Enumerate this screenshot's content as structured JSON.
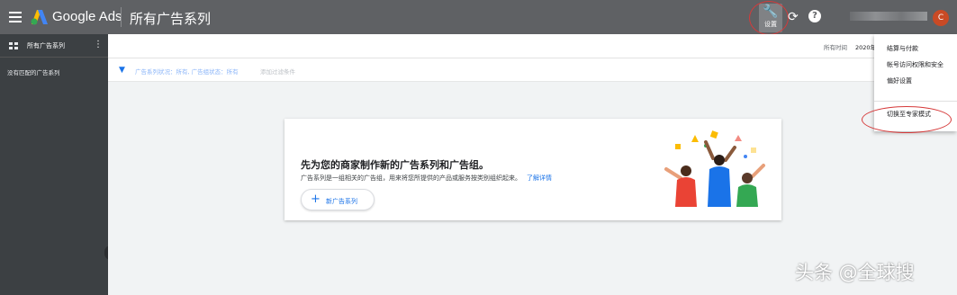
{
  "app": {
    "brand": "Google Ads",
    "page_title": "所有广告系列",
    "settings_label": "设置",
    "avatar_initial": "C"
  },
  "sidebar": {
    "title": "所有广告系列",
    "empty_text": "没有匹配的广告系列"
  },
  "datebar": {
    "label": "所有时间",
    "value": "2020年"
  },
  "filter": {
    "status_text": "广告系列状况：所有, 广告组状态：所有",
    "add_filter": "添加过滤条件"
  },
  "card": {
    "title": "先为您的商家制作新的广告系列和广告组。",
    "description": "广告系列是一组相关的广告组，用来将您所提供的产品或服务按类别组织起来。",
    "link": "了解详情",
    "new_button": "新广告系列"
  },
  "menu": {
    "items": [
      "结算与付款",
      "帐号访问权限和安全",
      "偏好设置",
      "切换至专家模式"
    ]
  },
  "watermark": "头条 @全球搜",
  "colors": {
    "topbar": "#5f6164",
    "sidebar": "#3c4043",
    "accent": "#1a73e8",
    "highlight_circle": "#d63a3a",
    "avatar": "#c94a25"
  }
}
